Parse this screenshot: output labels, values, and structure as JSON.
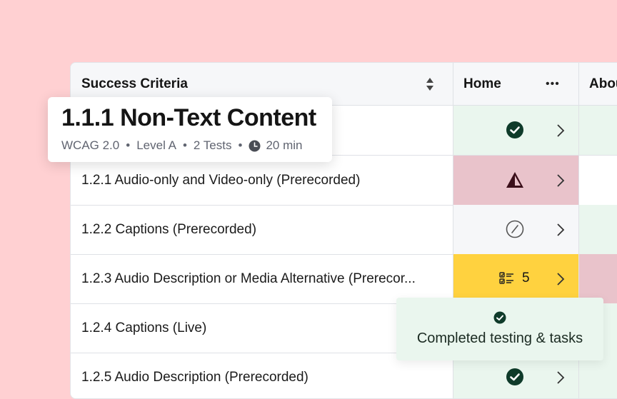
{
  "table": {
    "header": {
      "criteria_label": "Success Criteria",
      "col_home": "Home",
      "col_next": "Abou"
    },
    "rows": [
      {
        "label": "",
        "status": "pass",
        "bg": "#eaf6ee",
        "next_bg": "#eaf6ee"
      },
      {
        "label": "1.2.1 Audio-only and Video-only (Prerecorded)",
        "status": "fail",
        "bg": "#e9c3cb",
        "next_bg": "#ffffff"
      },
      {
        "label": "1.2.2 Captions (Prerecorded)",
        "status": "not-applicable",
        "bg": "#f6f7f9",
        "next_bg": "#eaf6ee"
      },
      {
        "label": "1.2.3 Audio Description or Media Alternative (Prerecor...",
        "status": "tasks",
        "count": "5",
        "bg": "#ffd23f",
        "next_bg": "#e9c3cb"
      },
      {
        "label": "1.2.4 Captions (Live)",
        "status": "",
        "bg": "#eaf6ee",
        "next_bg": "#eaf6ee"
      },
      {
        "label": "1.2.5 Audio Description (Prerecorded)",
        "status": "pass",
        "bg": "#eaf6ee",
        "next_bg": "#eaf6ee"
      }
    ]
  },
  "tooltip": {
    "title": "1.1.1 Non-Text Content",
    "standard": "WCAG 2.0",
    "level": "Level A",
    "tests": "2 Tests",
    "duration": "20 min",
    "separator": "•"
  },
  "toast": {
    "message": "Completed testing & tasks"
  },
  "icons": {
    "sort": "sort-icon",
    "more": "more-horizontal-icon",
    "pass": "check-circle-icon",
    "fail": "warning-triangle-icon",
    "na": "not-applicable-icon",
    "tasks": "checklist-icon",
    "chevron": "chevron-right-icon",
    "clock": "clock-icon"
  },
  "colors": {
    "background": "#ffd0d2",
    "pass": "#0f3b2a",
    "fail_bg": "#e9c3cb",
    "warning_bg": "#ffd23f",
    "pass_bg": "#eaf6ee"
  }
}
